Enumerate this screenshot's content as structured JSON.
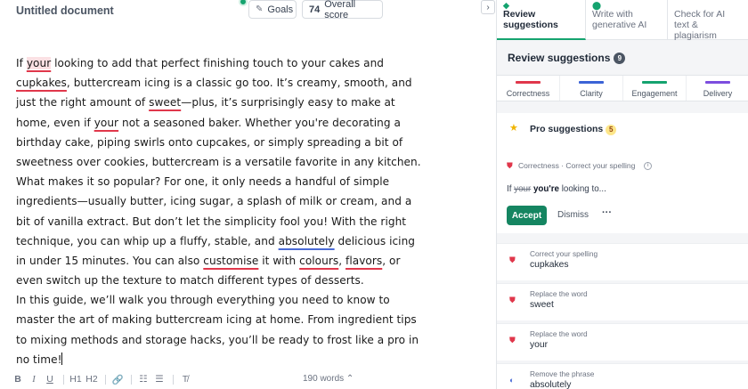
{
  "document": {
    "title": "Untitled document",
    "goals_label": "Goals",
    "score_value": "74",
    "score_label": "Overall score",
    "collapse_icon": "chevron-right-icon",
    "word_count": "190 words"
  },
  "text": {
    "l1_a": "If ",
    "l1_err": "your",
    "l1_b": " looking to add that perfect finishing touch to your cakes and",
    "l2_err": "cupkakes",
    "l2_b": ", buttercream icing is a classic go too. It’s creamy, smooth, and",
    "l3_a": "just the right amount of ",
    "l3_err": "sweet",
    "l3_b": "—plus, it’s surprisingly easy to make at",
    "l4_a": "home, even if ",
    "l4_err": "your",
    "l4_b": " not a seasoned baker. Whether you're decorating a",
    "l5": "birthday cake, piping swirls onto cupcakes, or simply spreading a bit of",
    "l6": "sweetness over cookies, buttercream is a versatile favorite in any kitchen.",
    "l7": "What makes it so popular? For one, it only needs a handful of simple",
    "l8": "ingredients—usually butter, icing sugar, a splash of milk or cream, and a",
    "l9": "bit of vanilla extract. But don’t let the simplicity fool you! With the right",
    "l10_a": "technique, you can whip up a fluffy, stable, and ",
    "l10_err": "absolutely",
    "l10_b": " delicious icing",
    "l11_a": "in under 15 minutes. You can also ",
    "l11_err1": "customise",
    "l11_b": " it with ",
    "l11_err2": "colours",
    "l11_c": ", ",
    "l11_err3": "flavors",
    "l11_d": ", or",
    "l12": "even switch up the texture to match different types of desserts.",
    "l13": "In this guide, we’ll walk you through everything you need to know to",
    "l14": "master the art of making buttercream icing at home. From ingredient tips",
    "l15": "to mixing methods and storage hacks, you’ll be ready to frost like a pro in",
    "l16": "no time!"
  },
  "toolbar": {
    "bold": "B",
    "italic": "I",
    "underline": "U",
    "h1": "H1",
    "h2": "H2",
    "link_icon": "🔗",
    "ol_icon": "☷",
    "ul_icon": "☰",
    "clear_icon": "T̸"
  },
  "panel": {
    "tabs": [
      {
        "label": "Review suggestions",
        "icon": "grammarly-g-icon"
      },
      {
        "label": "Write with generative AI",
        "icon": "pin-icon"
      },
      {
        "label": "Check for AI text & plagiarism",
        "icon": "shield-check-icon"
      }
    ],
    "title": "Review suggestions",
    "title_count": "9",
    "categories": [
      {
        "label": "Correctness",
        "color": "#e0374b"
      },
      {
        "label": "Clarity",
        "color": "#3b63d6"
      },
      {
        "label": "Engagement",
        "color": "#15a36f"
      },
      {
        "label": "Delivery",
        "color": "#7c4dde"
      }
    ],
    "pro": {
      "label": "Pro suggestions",
      "count": "5"
    },
    "main_card": {
      "header": "Correctness · Correct your spelling",
      "prefix": "If ",
      "removed": "your",
      "inserted": "you're",
      "suffix": " looking to...",
      "accept": "Accept",
      "dismiss": "Dismiss",
      "more": "···"
    },
    "suggestions": [
      {
        "type": "Correct your spelling",
        "word": "cupkakes"
      },
      {
        "type": "Replace the word",
        "word": "sweet"
      },
      {
        "type": "Replace the word",
        "word": "your"
      },
      {
        "type": "Remove the phrase",
        "word": "absolutely"
      }
    ]
  }
}
